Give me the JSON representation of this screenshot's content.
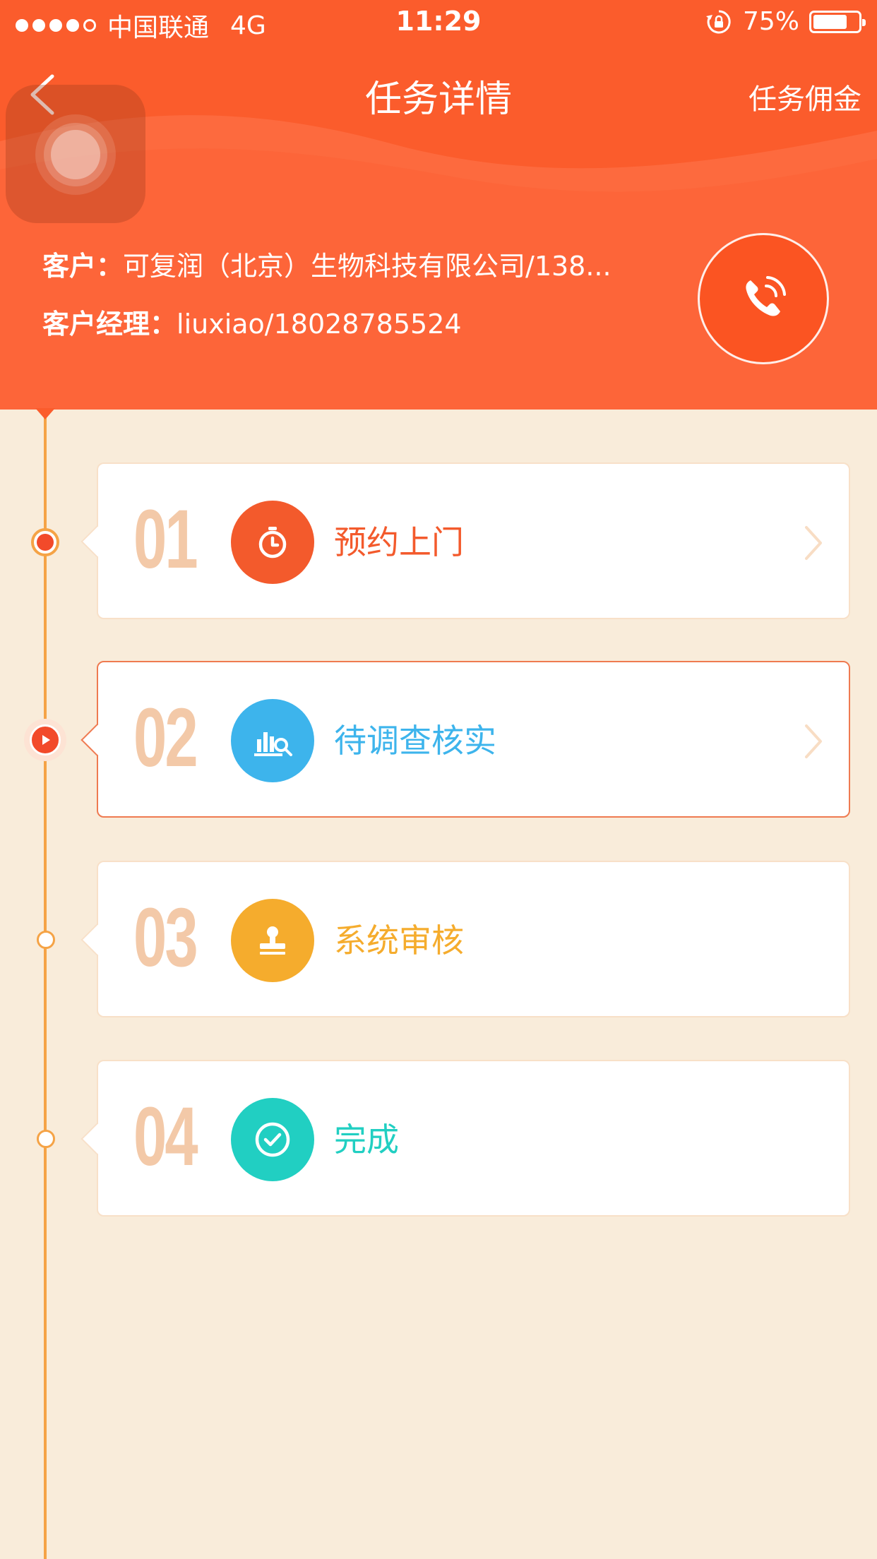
{
  "status_bar": {
    "carrier": "中国联通",
    "network": "4G",
    "time": "11:29",
    "battery": "75%",
    "battery_level": 0.75
  },
  "nav": {
    "title": "任务详情",
    "right_action": "任务佣金"
  },
  "customer": {
    "label": "客户：",
    "value": "可复润（北京）生物科技有限公司/138..."
  },
  "manager": {
    "label": "客户经理：",
    "value": "liuxiao/18028785524"
  },
  "steps": [
    {
      "number": "01",
      "label": "预约上门",
      "color": "#f35a2c",
      "icon": "stopwatch-icon",
      "state": "done",
      "has_chevron": true
    },
    {
      "number": "02",
      "label": "待调查核实",
      "color": "#3db4ec",
      "icon": "chart-search-icon",
      "state": "current",
      "has_chevron": true
    },
    {
      "number": "03",
      "label": "系统审核",
      "color": "#f5ac2d",
      "icon": "stamp-icon",
      "state": "pending",
      "has_chevron": false
    },
    {
      "number": "04",
      "label": "完成",
      "color": "#21cfc2",
      "icon": "check-circle-icon",
      "state": "pending",
      "has_chevron": false
    }
  ],
  "colors": {
    "header": "#fb5c2c",
    "background": "#f9ecda",
    "timeline": "#f5a346",
    "step_number": "#f3c9a8"
  }
}
